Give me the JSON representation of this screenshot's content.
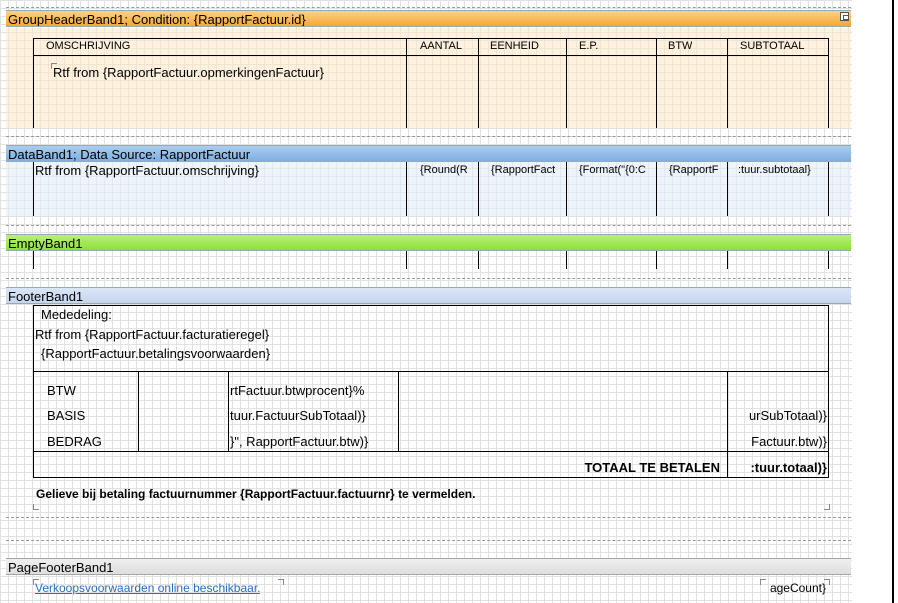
{
  "group_header": {
    "title": "GroupHeaderBand1; Condition: {RapportFactuur.id}",
    "columns": [
      "OMSCHRIJVING",
      "AANTAL",
      "EENHEID",
      "E.P.",
      "BTW",
      "SUBTOTAAL"
    ],
    "rtf_text": "Rtf from {RapportFactuur.opmerkingenFactuur}"
  },
  "data_band": {
    "title": "DataBand1; Data Source: RapportFactuur",
    "description": "Rtf from {RapportFactuur.omschrijving}",
    "cells": [
      "{Round(R",
      "{RapportFact",
      "{Format(\"{0:C",
      "{RapportF",
      ":tuur.subtotaal}"
    ]
  },
  "empty_band": {
    "title": "EmptyBand1"
  },
  "footer_band": {
    "title": "FooterBand1",
    "mededeling": "Mededeling:",
    "rtf_text": "Rtf from {RapportFactuur.facturatieregel}",
    "betalingsvoorwaarden": "{RapportFactuur.betalingsvoorwaarden}",
    "rows": [
      {
        "label": "BTW",
        "value": "rtFactuur.btwprocent}%",
        "right": ""
      },
      {
        "label": "BASIS",
        "value": "tuur.FactuurSubTotaal)}",
        "right": "urSubTotaal)}"
      },
      {
        "label": "BEDRAG",
        "value": "}\", RapportFactuur.btw)}",
        "right": "Factuur.btw)}"
      }
    ],
    "total_label": "TOTAAL  TE BETALEN",
    "total_value": ":tuur.totaal)}",
    "notice": "Gelieve bij betaling factuurnummer {RapportFactuur.factuurnr} te vermelden."
  },
  "page_footer": {
    "title": "PageFooterBand1",
    "link": "Verkoopsvoorwaarden online beschikbaar.",
    "page_count": "ageCount}"
  },
  "colors": {
    "group_header": "#f8a732",
    "data_band": "#7fb0e0",
    "empty_band": "#8ee03a",
    "footer_band": "#c6d6ee",
    "page_footer": "#dedede",
    "link": "#2a6ebe"
  }
}
